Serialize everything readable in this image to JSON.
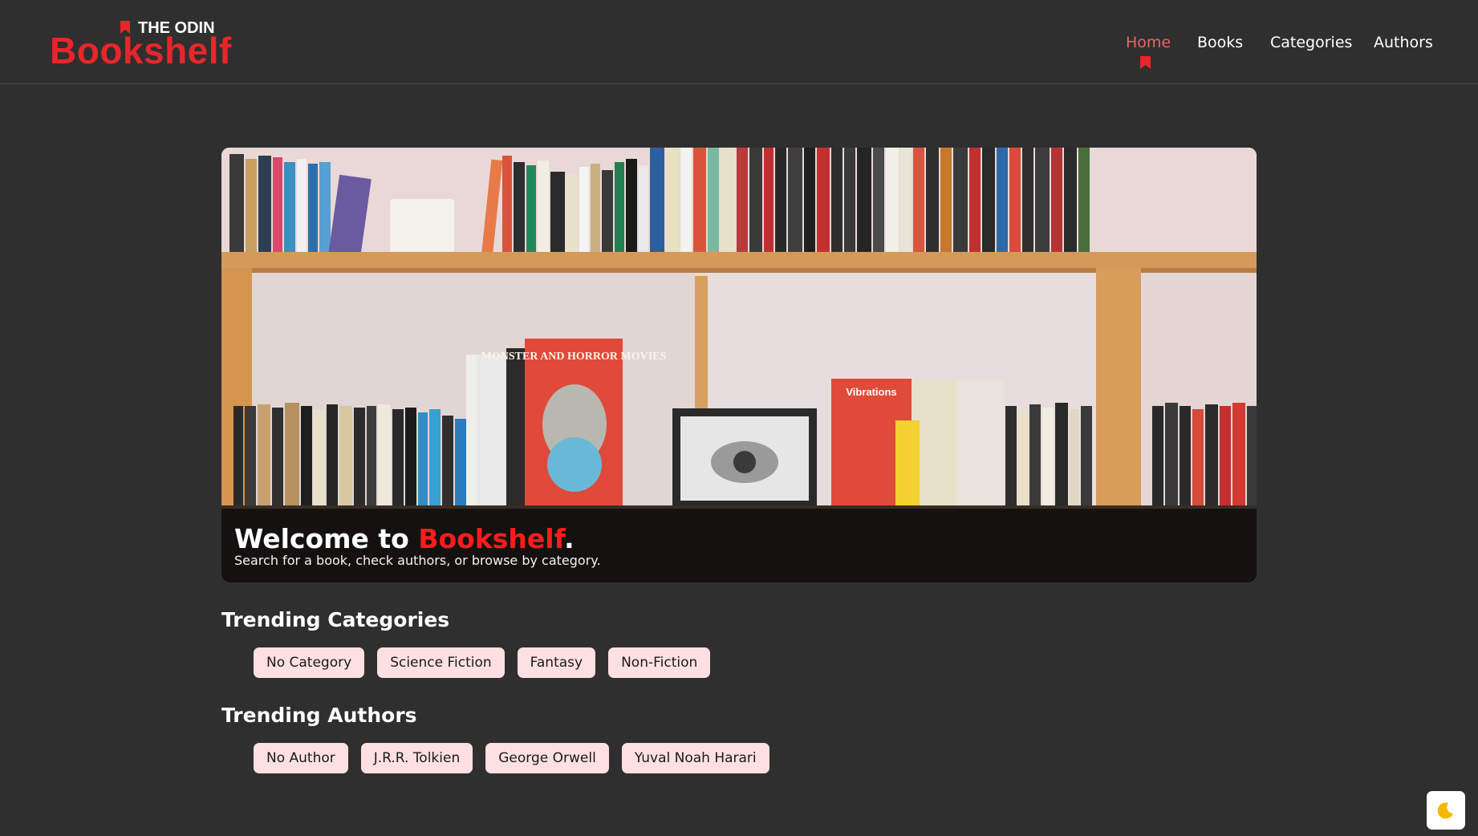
{
  "logo": {
    "top_text": "THE ODIN",
    "main_text": "Bookshelf"
  },
  "nav": {
    "items": [
      {
        "label": "Home",
        "active": true
      },
      {
        "label": "Books",
        "active": false
      },
      {
        "label": "Categories",
        "active": false
      },
      {
        "label": "Authors",
        "active": false
      }
    ]
  },
  "hero": {
    "title_prefix": "Welcome to ",
    "title_brand": "Bookshelf",
    "title_suffix": ".",
    "subtitle": "Search for a book, check authors, or browse by category.",
    "image_text": {
      "poster": "MONSTER AND HORROR MOVIES",
      "magazine": "Vibrations"
    }
  },
  "trending_categories": {
    "title": "Trending Categories",
    "items": [
      "No Category",
      "Science Fiction",
      "Fantasy",
      "Non-Fiction"
    ]
  },
  "trending_authors": {
    "title": "Trending Authors",
    "items": [
      "No Author",
      "J.R.R. Tolkien",
      "George Orwell",
      "Yuval Noah Harari"
    ]
  },
  "theme_toggle": {
    "icon": "moon-icon"
  },
  "colors": {
    "background": "#2f2f2f",
    "accent": "#e8262a",
    "nav_active": "#f06262",
    "chip_background": "#ffe0e0",
    "moon": "#f5b800"
  }
}
